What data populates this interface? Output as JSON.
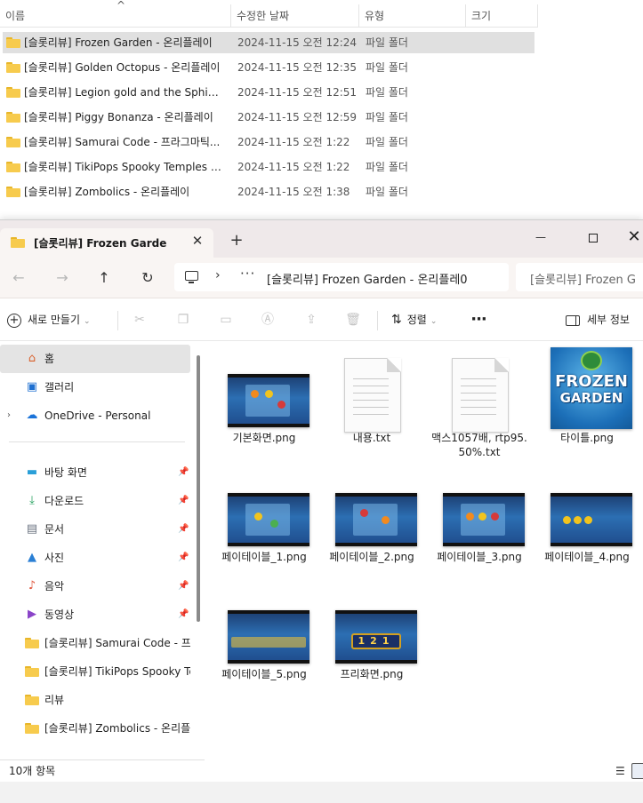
{
  "background_list": {
    "columns": [
      "이름",
      "수정한 날짜",
      "유형",
      "크기"
    ],
    "rows": [
      {
        "name": "[슬롯리뷰] Frozen Garden - 온리플레이",
        "date": "2024-11-15 오전 12:24",
        "type": "파일 폴더",
        "selected": true
      },
      {
        "name": "[슬롯리뷰] Golden Octopus - 온리플레이",
        "date": "2024-11-15 오전 12:35",
        "type": "파일 폴더"
      },
      {
        "name": "[슬롯리뷰] Legion gold and the Sphinx ...",
        "date": "2024-11-15 오전 12:51",
        "type": "파일 폴더"
      },
      {
        "name": "[슬롯리뷰] Piggy Bonanza - 온리플레이",
        "date": "2024-11-15 오전 12:59",
        "type": "파일 폴더"
      },
      {
        "name": "[슬롯리뷰] Samurai Code - 프라그마틱...",
        "date": "2024-11-15 오전 1:22",
        "type": "파일 폴더"
      },
      {
        "name": "[슬롯리뷰] TikiPops Spooky Temples - ...",
        "date": "2024-11-15 오전 1:22",
        "type": "파일 폴더"
      },
      {
        "name": "[슬롯리뷰] Zombolics - 온리플레이",
        "date": "2024-11-15 오전 1:38",
        "type": "파일 폴더"
      }
    ]
  },
  "window": {
    "tab_title": "[슬롯리뷰] Frozen Garden - 오",
    "tab_close": "✕",
    "tab_new": "+",
    "minimize": "—",
    "close": "✕"
  },
  "navbar": {
    "back": "←",
    "forward": "→",
    "up": "↑",
    "refresh": "↻",
    "chevron": "›",
    "more": "···",
    "path": "[슬롯리뷰] Frozen Garden - 온리플레0",
    "search": "[슬롯리뷰] Frozen G"
  },
  "toolbar": {
    "new_label": "새로 만들기",
    "sort_label": "정렬",
    "more": "···",
    "details_label": "세부 정보"
  },
  "sidebar": {
    "items": [
      {
        "label": "홈",
        "icon": "home-icon",
        "glyph": "⌂"
      },
      {
        "label": "갤러리",
        "icon": "gallery-icon",
        "glyph": "▣"
      },
      {
        "label": "OneDrive - Personal",
        "icon": "cloud-icon",
        "glyph": "☁"
      },
      {
        "label": "바탕 화면",
        "icon": "desktop-icon",
        "glyph": "▬"
      },
      {
        "label": "다운로드",
        "icon": "download-icon",
        "glyph": "⤓"
      },
      {
        "label": "문서",
        "icon": "documents-icon",
        "glyph": "▤"
      },
      {
        "label": "사진",
        "icon": "pictures-icon",
        "glyph": "▲"
      },
      {
        "label": "음악",
        "icon": "music-icon",
        "glyph": "♪"
      },
      {
        "label": "동영상",
        "icon": "video-icon",
        "glyph": "▶"
      },
      {
        "label": "[슬롯리뷰] Samurai Code - 프라",
        "icon": "folder-icon"
      },
      {
        "label": "[슬롯리뷰] TikiPops Spooky Te",
        "icon": "folder-icon"
      },
      {
        "label": "리뷰",
        "icon": "folder-icon"
      },
      {
        "label": "[슬롯리뷰] Zombolics - 온리플",
        "icon": "folder-icon"
      }
    ],
    "pin": "📌",
    "expand": "›"
  },
  "files": [
    {
      "name": "기본화면.png"
    },
    {
      "name": "내용.txt"
    },
    {
      "name": "맥스1057배, rtp95.50%.txt"
    },
    {
      "name": "타이틀.png"
    },
    {
      "name": "페이테이블_1.png"
    },
    {
      "name": "페이테이블_2.png"
    },
    {
      "name": "페이테이블_3.png"
    },
    {
      "name": "페이테이블_4.png"
    },
    {
      "name": "페이테이블_5.png"
    },
    {
      "name": "프리화면.png"
    }
  ],
  "title_thumb": {
    "line1": "FROZEN",
    "line2": "GARDEN"
  },
  "free_thumb_digits": "121",
  "status": {
    "count": "10개 항목"
  },
  "colors": {
    "folder": "#f7cb4d",
    "selection": "#e0e0e0",
    "accent": "#0067c0"
  }
}
